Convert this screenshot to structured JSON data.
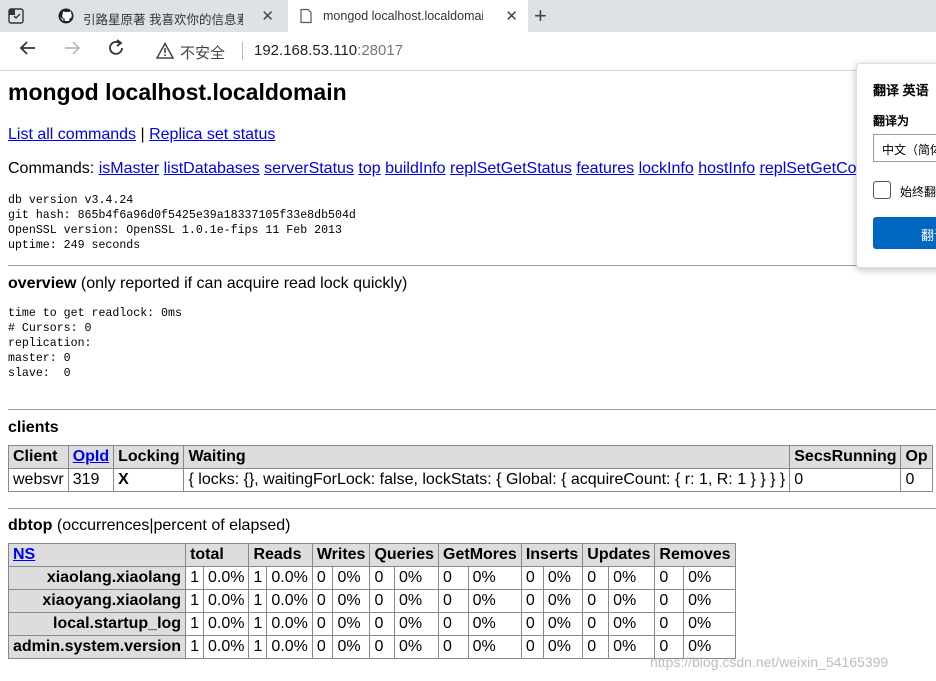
{
  "browser": {
    "tabs": [
      {
        "title": "引路星原著 我喜欢你的信息素广",
        "active": false
      },
      {
        "title": "mongod localhost.localdomain",
        "active": true
      }
    ],
    "new_tab": "+",
    "close": "✕",
    "security_text": "不安全",
    "url_host": "192.168.53.110",
    "url_port": ":28017"
  },
  "page": {
    "title": "mongod localhost.localdomain",
    "links": {
      "list_commands": "List all commands",
      "separator": " | ",
      "replica_status": "Replica set status"
    },
    "commands_label": "Commands: ",
    "commands": [
      "isMaster",
      "listDatabases",
      "serverStatus",
      "top",
      "buildInfo",
      "replSetGetStatus",
      "features",
      "lockInfo",
      "hostInfo",
      "replSetGetConfig"
    ],
    "version_info": "db version v3.4.24\ngit hash: 865b4f6a96d0f5425e39a18337105f33e8db504d\nOpenSSL version: OpenSSL 1.0.1e-fips 11 Feb 2013\nuptime: 249 seconds",
    "overview": {
      "title": "overview",
      "note": " (only reported if can acquire read lock quickly)",
      "body": "time to get readlock: 0ms\n# Cursors: 0\nreplication:\nmaster: 0\nslave:  0"
    },
    "clients": {
      "title": "clients",
      "headers": [
        "Client",
        "OpId",
        "Locking",
        "Waiting",
        "SecsRunning",
        "Op"
      ],
      "rows": [
        [
          "websvr",
          "319",
          "X",
          "{ locks: {}, waitingForLock: false, lockStats: { Global: { acquireCount: { r: 1, R: 1 } } } }",
          "0",
          "0"
        ]
      ]
    },
    "dbtop": {
      "title": "dbtop",
      "note": " (occurrences|percent of elapsed)",
      "headers": [
        "NS",
        "total",
        "Reads",
        "Writes",
        "Queries",
        "GetMores",
        "Inserts",
        "Updates",
        "Removes"
      ],
      "rows": [
        {
          "ns": "xiaolang.xiaolang",
          "cells": [
            "1",
            "0.0%",
            "1",
            "0.0%",
            "0",
            "0%",
            "0",
            "0%",
            "0",
            "0%",
            "0",
            "0%",
            "0",
            "0%",
            "0",
            "0%"
          ]
        },
        {
          "ns": "xiaoyang.xiaolang",
          "cells": [
            "1",
            "0.0%",
            "1",
            "0.0%",
            "0",
            "0%",
            "0",
            "0%",
            "0",
            "0%",
            "0",
            "0%",
            "0",
            "0%",
            "0",
            "0%"
          ]
        },
        {
          "ns": "local.startup_log",
          "cells": [
            "1",
            "0.0%",
            "1",
            "0.0%",
            "0",
            "0%",
            "0",
            "0%",
            "0",
            "0%",
            "0",
            "0%",
            "0",
            "0%",
            "0",
            "0%"
          ]
        },
        {
          "ns": "admin.system.version",
          "cells": [
            "1",
            "0.0%",
            "1",
            "0.0%",
            "0",
            "0%",
            "0",
            "0%",
            "0",
            "0%",
            "0",
            "0%",
            "0",
            "0%",
            "0",
            "0%"
          ]
        }
      ]
    }
  },
  "translate_popup": {
    "title": "翻译 英语",
    "translate_to_label": "翻译为",
    "target_language": "中文（简体）",
    "always_label": "始终翻",
    "button": "翻译"
  },
  "watermark": "https://blog.csdn.net/weixin_54165399",
  "colors": {
    "link": "#0000ee",
    "header_bg": "#dddddd",
    "accent": "#0067c0"
  }
}
